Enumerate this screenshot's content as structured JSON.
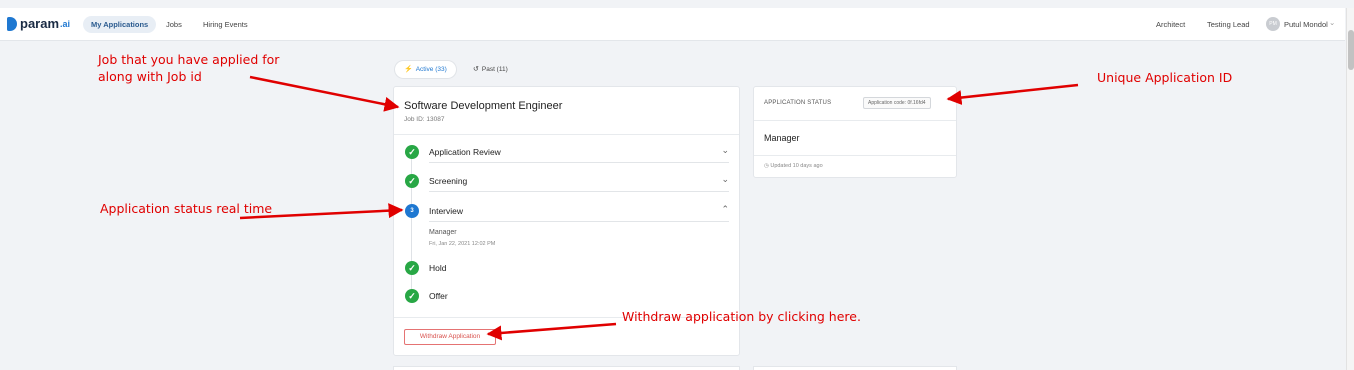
{
  "nav": {
    "logo_text": "param",
    "logo_suffix": ".ai",
    "items": [
      "My Applications",
      "Jobs",
      "Hiring Events"
    ],
    "right_items": [
      "Architect",
      "Testing Lead"
    ],
    "user_initials": "PM",
    "user_name": "Putul Mondol",
    "user_chevron": "⌄"
  },
  "tabs": [
    {
      "icon": "⚡",
      "label": "Active (33)"
    },
    {
      "icon": "↺",
      "label": "Past (11)"
    }
  ],
  "job": {
    "title": "Software Development Engineer",
    "job_id": "Job ID: 13087",
    "steps": [
      {
        "label": "Application Review",
        "icon": "✓",
        "chevron": "⌄"
      },
      {
        "label": "Screening",
        "icon": "✓",
        "chevron": "⌄"
      },
      {
        "label": "Interview",
        "icon": "3",
        "chevron": "⌃"
      },
      {
        "label": "Hold",
        "icon": "✓"
      },
      {
        "label": "Offer",
        "icon": "✓"
      }
    ],
    "interview_detail": {
      "label": "Manager",
      "time": "Fri, Jan 22, 2021 12:02 PM"
    },
    "withdraw_label": "Withdraw Application"
  },
  "status": {
    "heading": "APPLICATION STATUS",
    "code": "Application code: 0f.16fd4",
    "value": "Manager",
    "updated_icon": "◷",
    "updated": "Updated 10 days ago"
  },
  "annotations": {
    "job_note_line1": "Job that you have applied for",
    "job_note_line2": "along with Job id",
    "status_note": "Application status real time",
    "unique_id_note": "Unique Application ID",
    "withdraw_note": "Withdraw application by clicking here."
  },
  "colors": {
    "accent": "#1f78d1",
    "success": "#28a745",
    "danger": "#d9534f",
    "annotation": "#e00000"
  }
}
